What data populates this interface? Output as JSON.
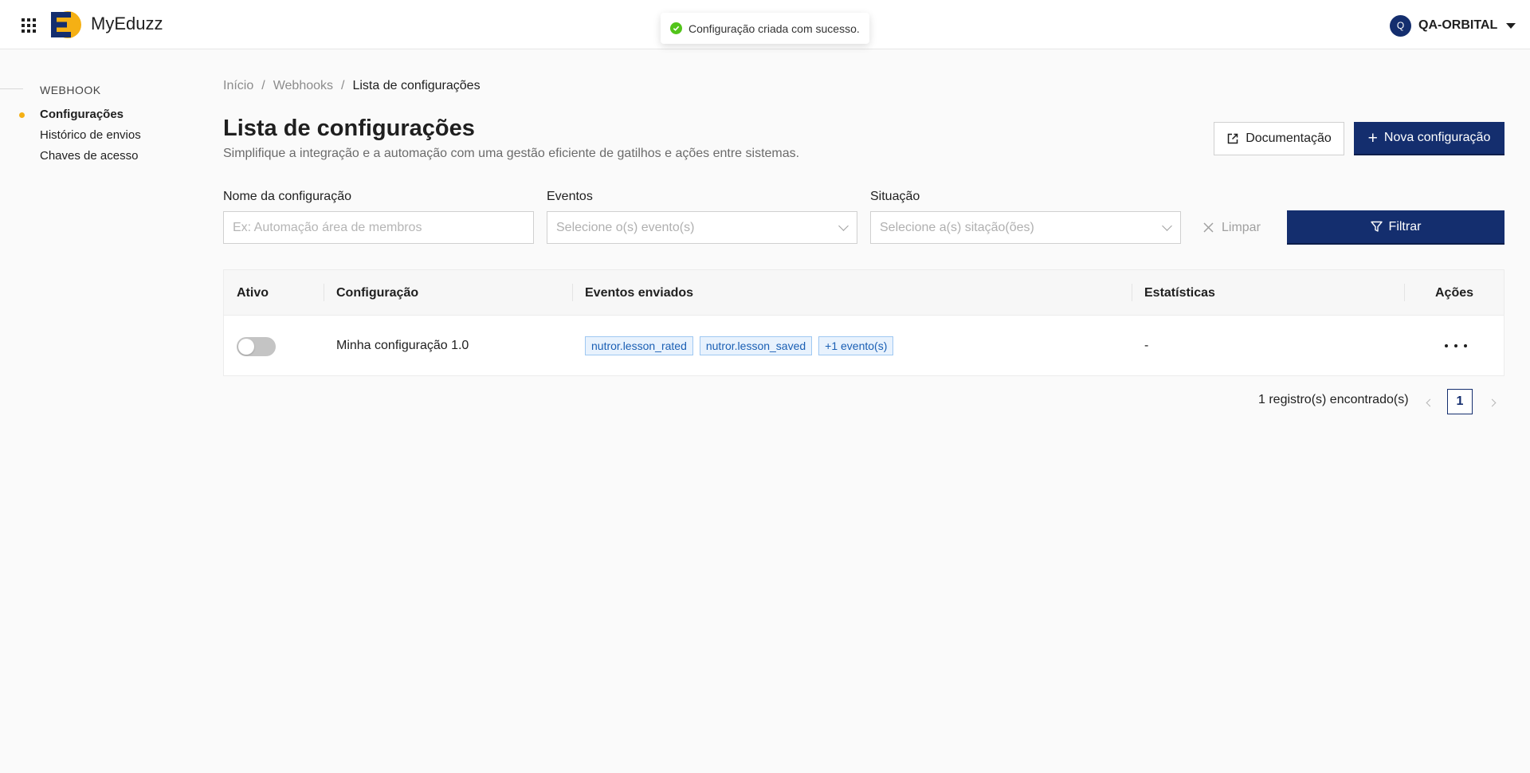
{
  "header": {
    "brand": "MyEduzz",
    "user_initial": "Q",
    "user_name": "QA-ORBITAL"
  },
  "toast": {
    "message": "Configuração criada com sucesso.",
    "status_color": "#52c41a"
  },
  "sidebar": {
    "section_title": "WEBHOOK",
    "items": [
      {
        "label": "Configurações",
        "active": true
      },
      {
        "label": "Histórico de envios",
        "active": false
      },
      {
        "label": "Chaves de acesso",
        "active": false
      }
    ]
  },
  "breadcrumb": {
    "items": [
      "Início",
      "Webhooks",
      "Lista de configurações"
    ],
    "separator": "/"
  },
  "page": {
    "title": "Lista de configurações",
    "subtitle": "Simplifique a integração e a automação com uma gestão eficiente de gatilhos e ações entre sistemas.",
    "doc_button": "Documentação",
    "new_button": "Nova configuração",
    "new_button_icon": "+"
  },
  "filters": {
    "name_label": "Nome da configuração",
    "name_placeholder": "Ex: Automação área de membros",
    "events_label": "Eventos",
    "events_placeholder": "Selecione o(s) evento(s)",
    "status_label": "Situação",
    "status_placeholder": "Selecione a(s) sitação(ões)",
    "clear_button": "Limpar",
    "filter_button": "Filtrar"
  },
  "table": {
    "columns": [
      "Ativo",
      "Configuração",
      "Eventos enviados",
      "Estatísticas",
      "Ações"
    ],
    "rows": [
      {
        "active": false,
        "name": "Minha configuração 1.0",
        "events": [
          "nutror.lesson_rated",
          "nutror.lesson_saved",
          "+1 evento(s)"
        ],
        "stats": "-"
      }
    ]
  },
  "pagination": {
    "count_text": "1 registro(s) encontrado(s)",
    "current_page": "1"
  },
  "colors": {
    "primary": "#142e6e",
    "accent": "#f5b014",
    "tag_bg": "#e8f2fd",
    "tag_text": "#1a5fb4"
  }
}
